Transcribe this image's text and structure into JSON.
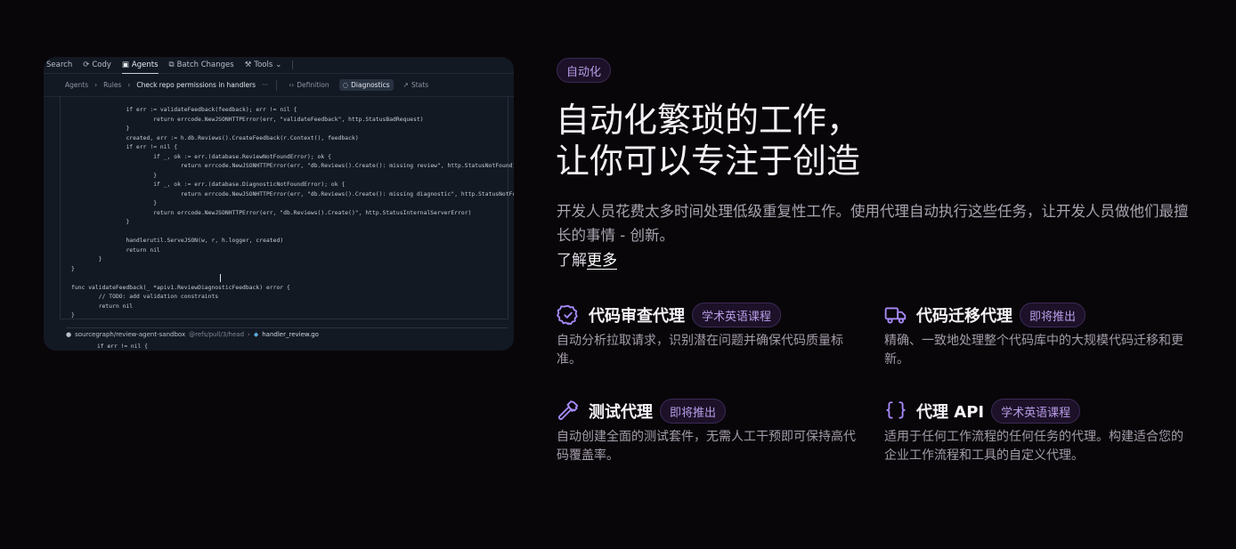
{
  "editor": {
    "topbar": {
      "search": "Search",
      "cody": "Cody",
      "agents": "Agents",
      "batch_changes": "Batch Changes",
      "tools": "Tools"
    },
    "breadcrumbs": {
      "agents": "Agents",
      "rules": "Rules",
      "current": "Check repo permissions in handlers",
      "more": "···",
      "definition": "Definition",
      "diagnostics": "Diagnostics",
      "stats": "Stats"
    },
    "code": "\t\tif err := validateFeedback(feedback); err != nil {\n\t\t\treturn errcode.NewJSONHTTPError(err, \"validateFeedback\", http.StatusBadRequest)\n\t\t}\n\t\tcreated, err := h.db.Reviews().CreateFeedback(r.Context(), feedback)\n\t\tif err != nil {\n\t\t\tif _, ok := err.(database.ReviewNotFoundError); ok {\n\t\t\t\treturn errcode.NewJSONHTTPError(err, \"db.Reviews().Create(): missing review\", http.StatusNotFound)\n\t\t\t}\n\t\t\tif _, ok := err.(database.DiagnosticNotFoundError); ok {\n\t\t\t\treturn errcode.NewJSONHTTPError(err, \"db.Reviews().Create(): missing diagnostic\", http.StatusNotFound)\n\t\t\t}\n\t\t\treturn errcode.NewJSONHTTPError(err, \"db.Reviews().Create()\", http.StatusInternalServerError)\n\t\t}\n\n\t\thandlerutil.ServeJSON(w, r, h.logger, created)\n\t\treturn nil\n\t}\n}\n\nfunc validateFeedback(_ *apiv1.ReviewDiagnosticFeedback) error {\n\t// TODO: add validation constraints\n\treturn nil\n}",
    "footer": {
      "repo": "sourcegraph/review-agent-sandbox",
      "ref": "@refs/pull/3/head",
      "sep": "›",
      "file": "handler_review.go"
    },
    "next_line": "if err != nil {"
  },
  "hero": {
    "tag": "自动化",
    "headline_line1": "自动化繁琐的工作，",
    "headline_line2": "让你可以专注于创造",
    "description": "开发人员花费太多时间处理低级重复性工作。使用代理自动执行这些任务，让开发人员做他们最擅长的事情 - 创新。",
    "learn_prefix": "了解",
    "learn_link": "更多"
  },
  "features": [
    {
      "icon": "badge-check-icon",
      "title": "代码审查代理",
      "badge": "学术英语课程",
      "text": "自动分析拉取请求，识别潜在问题并确保代码质量标准。"
    },
    {
      "icon": "truck-icon",
      "title": "代码迁移代理",
      "badge": "即将推出",
      "text": "精确、一致地处理整个代码库中的大规模代码迁移和更新。"
    },
    {
      "icon": "hammer-icon",
      "title": "测试代理",
      "badge": "即将推出",
      "text": "自动创建全面的测试套件，无需人工干预即可保持高代码覆盖率。"
    },
    {
      "icon": "braces-icon",
      "title": "代理 API",
      "badge": "学术英语课程",
      "text": "适用于任何工作流程的任何任务的代理。构建适合您的企业工作流程和工具的自定义代理。"
    }
  ],
  "colors": {
    "background": "#09060a",
    "accent": "#a78bfa",
    "pill_bg": "#1c1128",
    "pill_border": "#3b2a55",
    "editor_bg": "#131923"
  }
}
